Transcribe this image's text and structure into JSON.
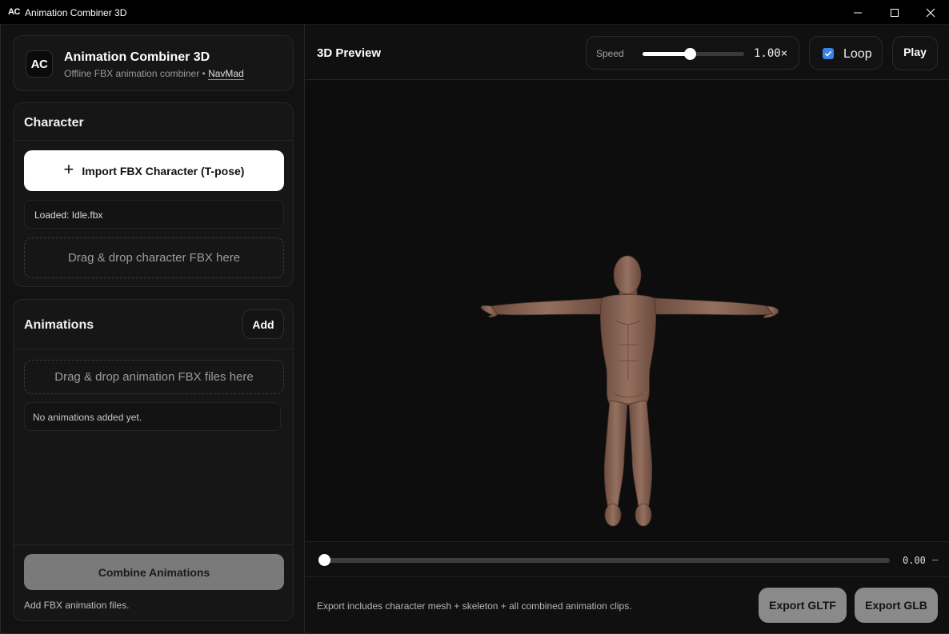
{
  "window": {
    "icon_text": "AC",
    "title": "Animation Combiner 3D",
    "controls": [
      "minimize",
      "maximize",
      "close"
    ]
  },
  "brand": {
    "logo_text": "AC",
    "title": "Animation Combiner 3D",
    "subtitle": "Offline FBX animation combiner •",
    "author": "NavMad"
  },
  "character": {
    "heading": "Character",
    "import_label": "Import FBX Character (T-pose)",
    "loaded_text": "Loaded: Idle.fbx",
    "drop_text": "Drag & drop character FBX here"
  },
  "animations": {
    "heading": "Animations",
    "add_label": "Add",
    "drop_text": "Drag & drop animation FBX files here",
    "empty_text": "No animations added yet.",
    "combine_label": "Combine Animations",
    "hint": "Add FBX animation files."
  },
  "preview": {
    "title": "3D Preview",
    "speed_label": "Speed",
    "speed_value": "1.00×",
    "speed_fraction": 0.47,
    "loop_label": "Loop",
    "loop_checked": true,
    "play_label": "Play"
  },
  "timeline": {
    "time": "0.00",
    "end": "–",
    "progress": 0
  },
  "export": {
    "note": "Export includes character mesh + skeleton + all combined animation clips.",
    "gltf_label": "Export GLTF",
    "glb_label": "Export GLB"
  },
  "colors": {
    "accent": "#3a82e6",
    "skin": "#8a6352",
    "background": "#0e0e0e"
  }
}
